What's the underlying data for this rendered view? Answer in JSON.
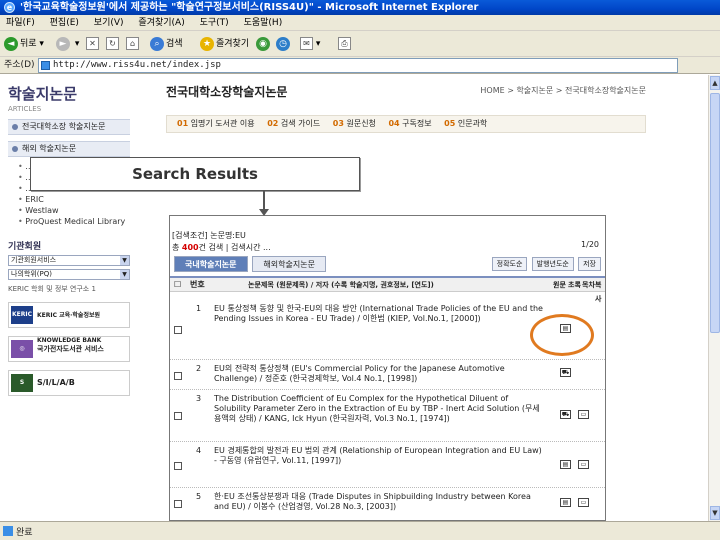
{
  "window": {
    "title": "'한국교육학술정보원'에서 제공하는 \"학술연구정보서비스(RISS4U)\" - Microsoft Internet Explorer"
  },
  "menu": [
    "파일(F)",
    "편집(E)",
    "보기(V)",
    "즐겨찾기(A)",
    "도구(T)",
    "도움말(H)"
  ],
  "toolbar": {
    "back": "뒤로",
    "search": "검색",
    "favorites": "즐겨찾기"
  },
  "address": {
    "label": "주소(D)",
    "url": "http://www.riss4u.net/index.jsp"
  },
  "sidebar": {
    "title": "학술지논문",
    "subtitle": "ARTICLES",
    "section1": "전국대학소장 학술지논문",
    "section2": "해외 학술지논문",
    "list": [
      "…",
      "…",
      "…",
      "ERIC",
      "Westlaw",
      "ProQuest Medical Library"
    ],
    "inst_title": "기관회원",
    "select1": "기관회원서비스",
    "select2": "나의학위(PQ)",
    "note": "KERIC 학회 및 정부 연구소 1",
    "logos": [
      "KERIC 교육·학술정보원 KNOWLEDGE BANK",
      "국가전자도서관 서비스",
      "S/I/L/A/B"
    ]
  },
  "main": {
    "title": "전국대학소장학술지논문",
    "crumb": "HOME > 학술지논문 > 전국대학소장학술지논문",
    "categories": [
      {
        "no": "01",
        "label": "임명기 도서관 이용"
      },
      {
        "no": "02",
        "label": "검색 가이드"
      },
      {
        "no": "03",
        "label": "원문신청"
      },
      {
        "no": "04",
        "label": "구독정보"
      },
      {
        "no": "05",
        "label": "인문과학"
      }
    ]
  },
  "callout": {
    "text": "Search Results"
  },
  "results": {
    "condition": "[검색조건] 논문명:EU",
    "summary_pre": "총",
    "summary_count": "400",
    "summary_post": "건 검색 | 검색시간 ...",
    "pagination": "1/20",
    "tabs": [
      "국내학술지논문",
      "해외학술지논문"
    ],
    "sort_buttons": [
      "정확도순",
      "발행년도순",
      "저장"
    ],
    "columns": {
      "num": "번호",
      "title": "논문제목 (원문제목) / 저자 (수록 학술지명, 권호정보, [연도])",
      "orig": "원문",
      "abstract": "초록",
      "request": "목차",
      "copy": "복사"
    },
    "rows": [
      {
        "num": "1",
        "title": "EU 통상정책 동향 및 한국-EU의 대응 방안 (International Trade Policies of the EU and the Pending Issues in Korea - EU Trade) / 이한범 (KIEP, Vol.No.1, [2000])"
      },
      {
        "num": "2",
        "title": "EU의 전략적 통상정책 (EU's Commercial Policy for the Japanese Automotive Challenge) / 정준호 (한국경제학보, Vol.4 No.1, [1998])"
      },
      {
        "num": "3",
        "title": "The Distribution Coefficient of Eu Complex for the Hypothetical Diluent of Solubility Parameter Zero in the Extraction of Eu by TBP - Inert Acid Solution (무세용액의 상태) / KANG, Ick Hyun (한국원자력, Vol.3 No.1, [1974])"
      },
      {
        "num": "4",
        "title": "EU 경제통합의 발전과 EU 법의 관계 (Relationship of European Integration and EU Law) - 구동영 (유럽연구, Vol.11, [1997])"
      },
      {
        "num": "5",
        "title": "한·EU 조선통상분쟁과 대응 (Trade Disputes in Shipbuilding Industry between Korea and EU) / 이봉수 (산업경영, Vol.28 No.3, [2003])"
      }
    ]
  },
  "status": {
    "text": "완료"
  }
}
